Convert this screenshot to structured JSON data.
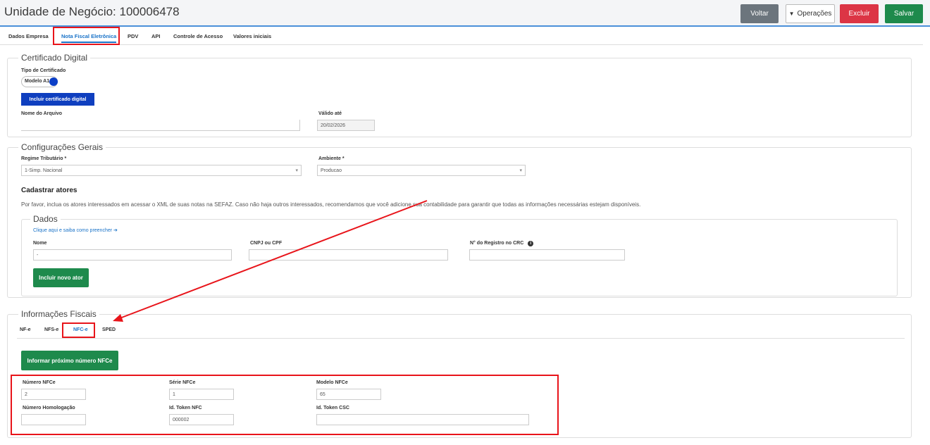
{
  "header": {
    "title": "Unidade de Negócio: 100006478",
    "voltar": "Voltar",
    "operacoes": "Operações",
    "excluir": "Excluir",
    "salvar": "Salvar"
  },
  "tabs": [
    {
      "label": "Dados Empresa"
    },
    {
      "label": "Nota Fiscal Eletrônica"
    },
    {
      "label": "PDV"
    },
    {
      "label": "API"
    },
    {
      "label": "Controle de Acesso"
    },
    {
      "label": "Valores iniciais"
    }
  ],
  "certificado": {
    "legend": "Certificado Digital",
    "tipo_label": "Tipo de Certificado",
    "tipo_value": "Modelo A1",
    "incluir_button": "Incluir certificado digital",
    "nome_label": "Nome do Arquivo",
    "nome_value": "",
    "valido_label": "Válido até",
    "valido_value": "20/02/2026"
  },
  "config": {
    "legend": "Configurações Gerais",
    "regime_label": "Regime Tributário *",
    "regime_value": "1-Simp. Nacional",
    "ambiente_label": "Ambiente *",
    "ambiente_value": "Producao",
    "atores_title": "Cadastrar atores",
    "atores_desc": "Por favor, inclua os atores interessados em acessar o XML de suas notas na SEFAZ. Caso não haja outros interessados, recomendamos que você adicione sua contabilidade para garantir que todas as informações necessárias estejam disponíveis."
  },
  "dados": {
    "legend": "Dados",
    "help_link": "Clique aqui e saiba como preencher",
    "nome_label": "Nome",
    "nome_value": "-",
    "cnpj_label": "CNPJ ou CPF",
    "cnpj_value": "",
    "crc_label": "N° do Registro no CRC",
    "crc_value": "",
    "incluir_button": "Incluir novo ator"
  },
  "fiscais": {
    "legend": "Informações Fiscais",
    "subtabs": [
      {
        "label": "NF-e"
      },
      {
        "label": "NFS-e"
      },
      {
        "label": "NFC-e"
      },
      {
        "label": "SPED"
      }
    ],
    "proximo_button": "Informar próximo número NFCe",
    "numero_label": "Número NFCe",
    "numero_value": "2",
    "serie_label": "Série NFCe",
    "serie_value": "1",
    "modelo_label": "Modelo NFCe",
    "modelo_value": "65",
    "homolog_label": "Número Homologação",
    "homolog_value": "",
    "token_label": "Id. Token NFC",
    "token_value": "000002",
    "csc_label": "Id. Token CSC",
    "csc_value": ""
  },
  "colors": {
    "accent": "#1a73c8",
    "success": "#1e8a4c",
    "danger": "#dc3545",
    "annotation": "#e8141a"
  }
}
